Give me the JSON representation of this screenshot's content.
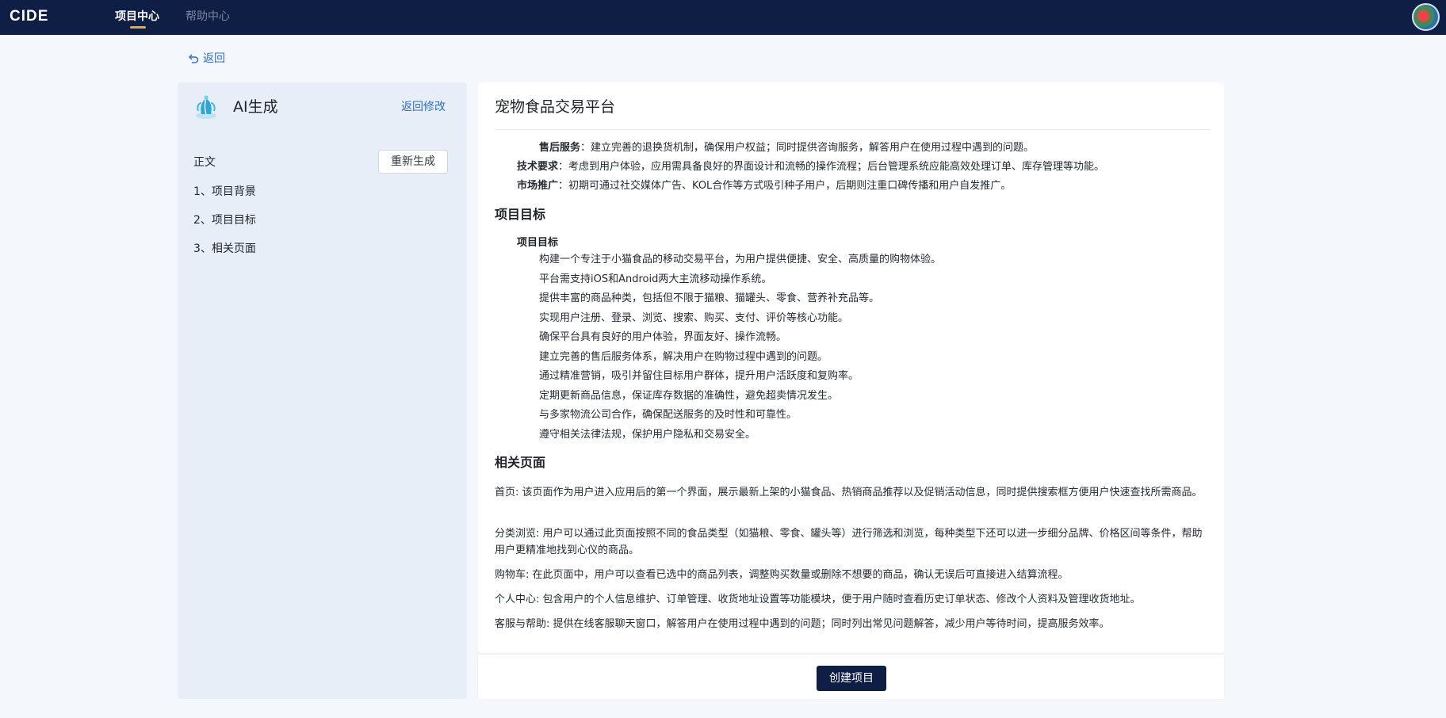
{
  "header": {
    "logo": "CIDE",
    "nav": [
      {
        "label": "项目中心",
        "active": true
      },
      {
        "label": "帮助中心",
        "active": false
      }
    ]
  },
  "back_label": "返回",
  "sidebar": {
    "title": "AI生成",
    "back_modify": "返回修改",
    "section_label": "正文",
    "regen_label": "重新生成",
    "outline": [
      "1、项目背景",
      "2、项目目标",
      "3、相关页面"
    ]
  },
  "document": {
    "title": "宠物食品交易平台",
    "background_lines": [
      {
        "label": "售后服务",
        "text": "：建立完善的退换货机制，确保用户权益；同时提供咨询服务，解答用户在使用过程中遇到的问题。"
      },
      {
        "label": "技术要求",
        "text": "：考虑到用户体验，应用需具备良好的界面设计和流畅的操作流程；后台管理系统应能高效处理订单、库存管理等功能。"
      },
      {
        "label": "市场推广",
        "text": "：初期可通过社交媒体广告、KOL合作等方式吸引种子用户，后期则注重口碑传播和用户自发推广。"
      }
    ],
    "goals_heading": "项目目标",
    "goals_subheading": "项目目标",
    "goals": [
      "构建一个专注于小猫食品的移动交易平台，为用户提供便捷、安全、高质量的购物体验。",
      "平台需支持iOS和Android两大主流移动操作系统。",
      "提供丰富的商品种类，包括但不限于猫粮、猫罐头、零食、营养补充品等。",
      "实现用户注册、登录、浏览、搜索、购买、支付、评价等核心功能。",
      "确保平台具有良好的用户体验，界面友好、操作流畅。",
      "建立完善的售后服务体系，解决用户在购物过程中遇到的问题。",
      "通过精准营销，吸引并留住目标用户群体，提升用户活跃度和复购率。",
      "定期更新商品信息，保证库存数据的准确性，避免超卖情况发生。",
      "与多家物流公司合作，确保配送服务的及时性和可靠性。",
      "遵守相关法律法规，保护用户隐私和交易安全。"
    ],
    "pages_heading": "相关页面",
    "pages": [
      "首页: 该页面作为用户进入应用后的第一个界面，展示最新上架的小猫食品、热销商品推荐以及促销活动信息，同时提供搜索框方便用户快速查找所需商品。",
      "分类浏览: 用户可以通过此页面按照不同的食品类型（如猫粮、零食、罐头等）进行筛选和浏览，每种类型下还可以进一步细分品牌、价格区间等条件，帮助用户更精准地找到心仪的商品。",
      "购物车: 在此页面中，用户可以查看已选中的商品列表，调整购买数量或删除不想要的商品，确认无误后可直接进入结算流程。",
      "个人中心: 包含用户的个人信息维护、订单管理、收货地址设置等功能模块，便于用户随时查看历史订单状态、修改个人资料及管理收货地址。",
      "客服与帮助: 提供在线客服聊天窗口，解答用户在使用过程中遇到的问题；同时列出常见问题解答，减少用户等待时间，提高服务效率。"
    ]
  },
  "footer": {
    "create_label": "创建项目"
  },
  "colors": {
    "nav_bg": "#0f1e45",
    "accent": "#2f6fd6",
    "nav_active_underline": "#f5a623",
    "sidebar_bg": "#e8eef8",
    "page_bg": "#f4f7fb"
  }
}
